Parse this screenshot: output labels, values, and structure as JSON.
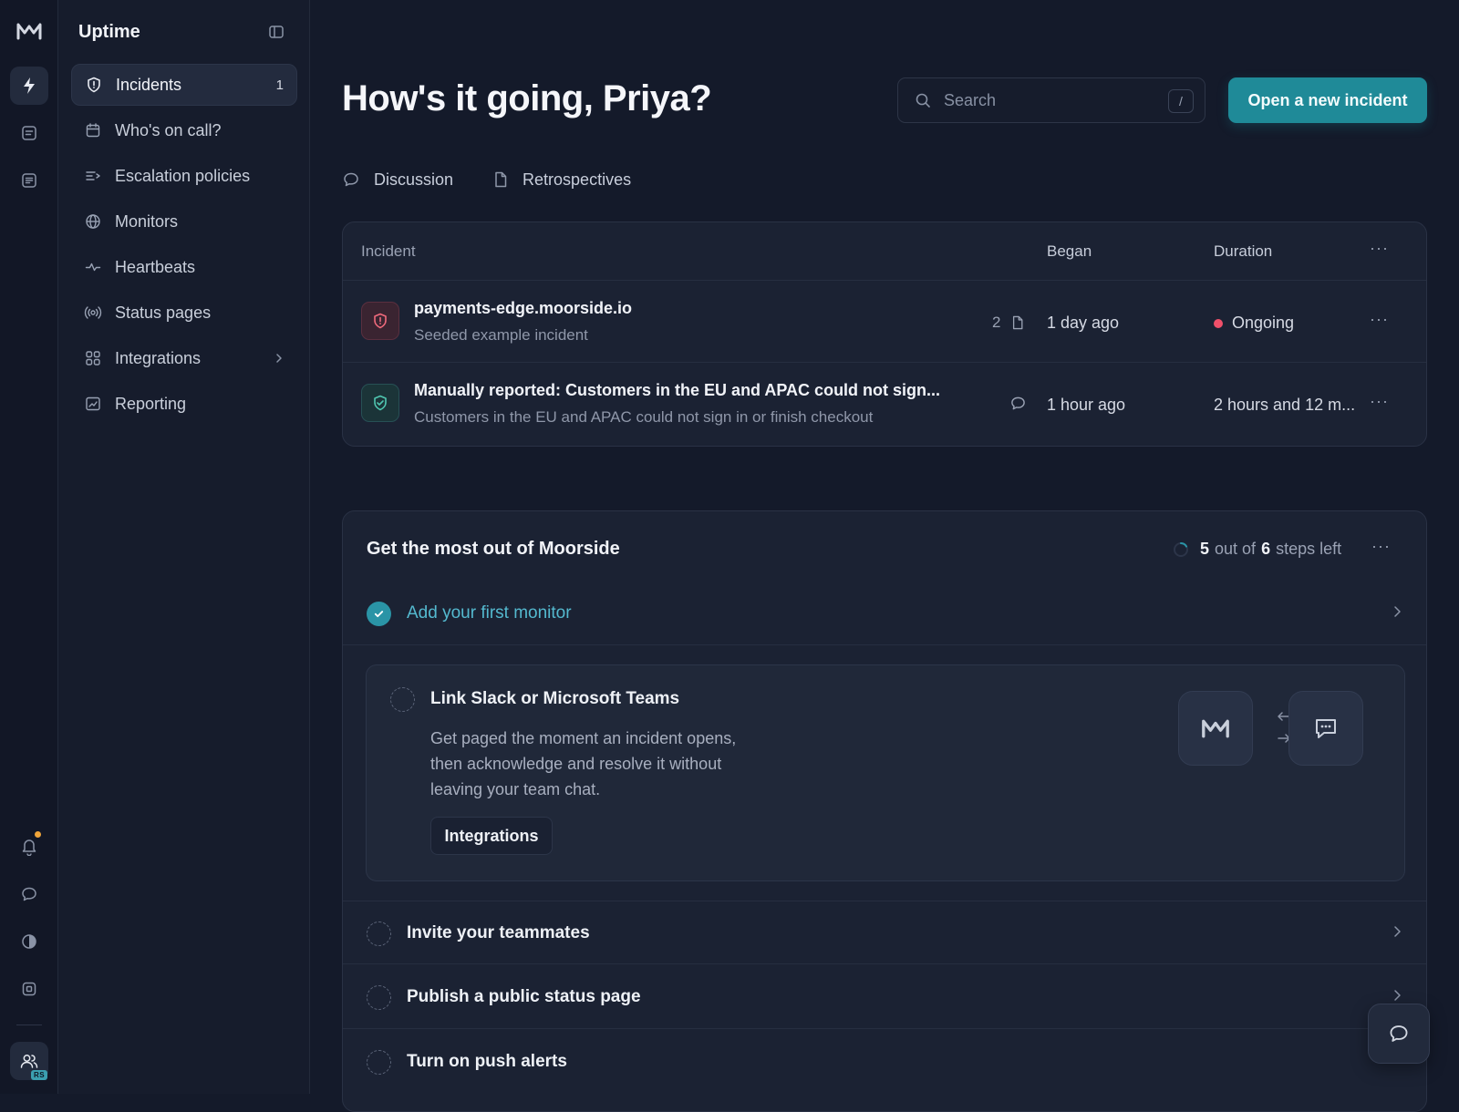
{
  "app": {
    "section_title": "Uptime",
    "user_initials": "RS"
  },
  "sidebar": {
    "items": [
      {
        "label": "Incidents",
        "count": "1",
        "icon": "shield-icon"
      },
      {
        "label": "Who's on call?",
        "icon": "calendar-icon"
      },
      {
        "label": "Escalation policies",
        "icon": "escalation-icon"
      },
      {
        "label": "Monitors",
        "icon": "globe-icon"
      },
      {
        "label": "Heartbeats",
        "icon": "pulse-icon"
      },
      {
        "label": "Status pages",
        "icon": "broadcast-icon"
      },
      {
        "label": "Integrations",
        "icon": "grid-icon"
      },
      {
        "label": "Reporting",
        "icon": "chart-icon"
      }
    ]
  },
  "header": {
    "greeting": "How's it going, Priya?",
    "search_placeholder": "Search",
    "search_shortcut": "/",
    "primary_button": "Open a new incident"
  },
  "tabs": [
    {
      "label": "Discussion"
    },
    {
      "label": "Retrospectives"
    }
  ],
  "incidents_table": {
    "columns": [
      "Incident",
      "Began",
      "Duration"
    ],
    "rows": [
      {
        "title": "payments-edge.moorside.io",
        "subtitle": "Seeded example incident",
        "attachments": "2",
        "began": "1 day ago",
        "duration": "Ongoing",
        "status": "ongoing"
      },
      {
        "title": "Manually reported: Customers in the EU and APAC could not sign...",
        "subtitle": "Customers in the EU and APAC could not sign in or finish checkout",
        "began": "1 hour ago",
        "duration": "2 hours and 12 m...",
        "status": "resolved"
      }
    ]
  },
  "onboarding": {
    "title": "Get the most out of Moorside",
    "steps_left": "5",
    "steps_total": "6",
    "steps_text_1": "out of",
    "steps_text_2": "steps left",
    "steps": [
      {
        "label": "Add your first monitor",
        "done": true
      },
      {
        "label": "Link Slack or Microsoft Teams",
        "description": "Get paged the moment an incident opens, then acknowledge and resolve it without leaving your team chat.",
        "button": "Integrations",
        "expanded": true
      },
      {
        "label": "Invite your teammates"
      },
      {
        "label": "Publish a public status page"
      },
      {
        "label": "Turn on push alerts"
      }
    ]
  },
  "colors": {
    "accent": "#1f8a98",
    "ongoing": "#f0506a",
    "notification": "#f0a53a"
  }
}
